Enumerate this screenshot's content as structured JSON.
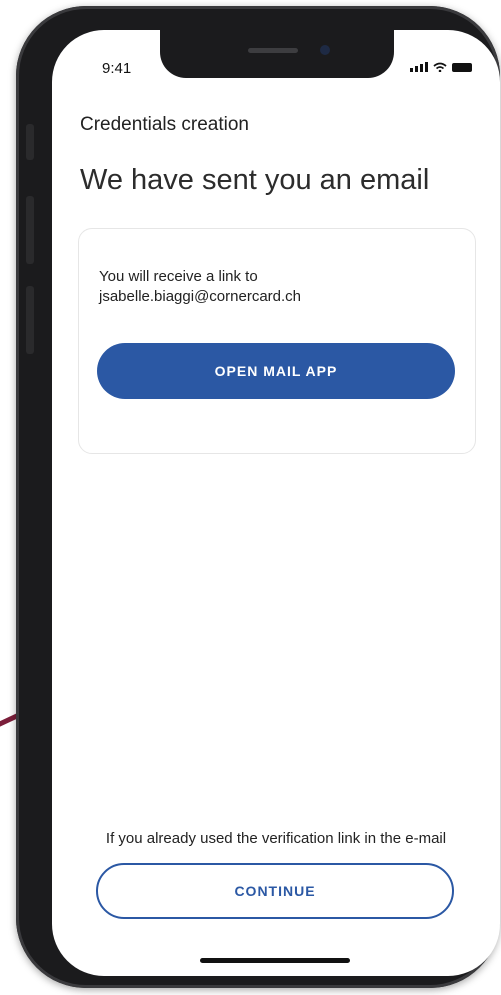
{
  "status_bar": {
    "time": "9:41"
  },
  "header": {
    "title": "Credentials creation"
  },
  "main": {
    "heading": "We have sent you an email",
    "card": {
      "message_line1": "You will receive a link to",
      "email": "jsabelle.biaggi@cornercard.ch",
      "open_mail_label": "OPEN MAIL APP"
    }
  },
  "footer": {
    "hint": "If you already used the verification link in the e-mail",
    "continue_label": "CONTINUE"
  },
  "colors": {
    "accent": "#2b58a4",
    "text": "#222222",
    "frame": "#1b1b1d"
  }
}
